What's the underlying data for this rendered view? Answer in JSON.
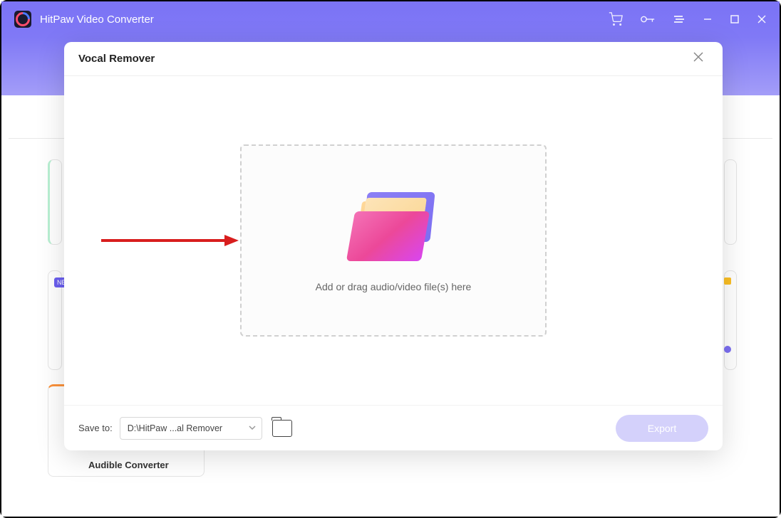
{
  "app": {
    "title": "HitPaw Video Converter"
  },
  "modal": {
    "title": "Vocal Remover",
    "drop_text": "Add or drag audio/video file(s) here",
    "footer": {
      "save_label": "Save to:",
      "save_path": "D:\\HitPaw ...al Remover",
      "export_label": "Export"
    }
  },
  "background": {
    "audible_label": "Audible Converter",
    "new_badge": "NE"
  }
}
